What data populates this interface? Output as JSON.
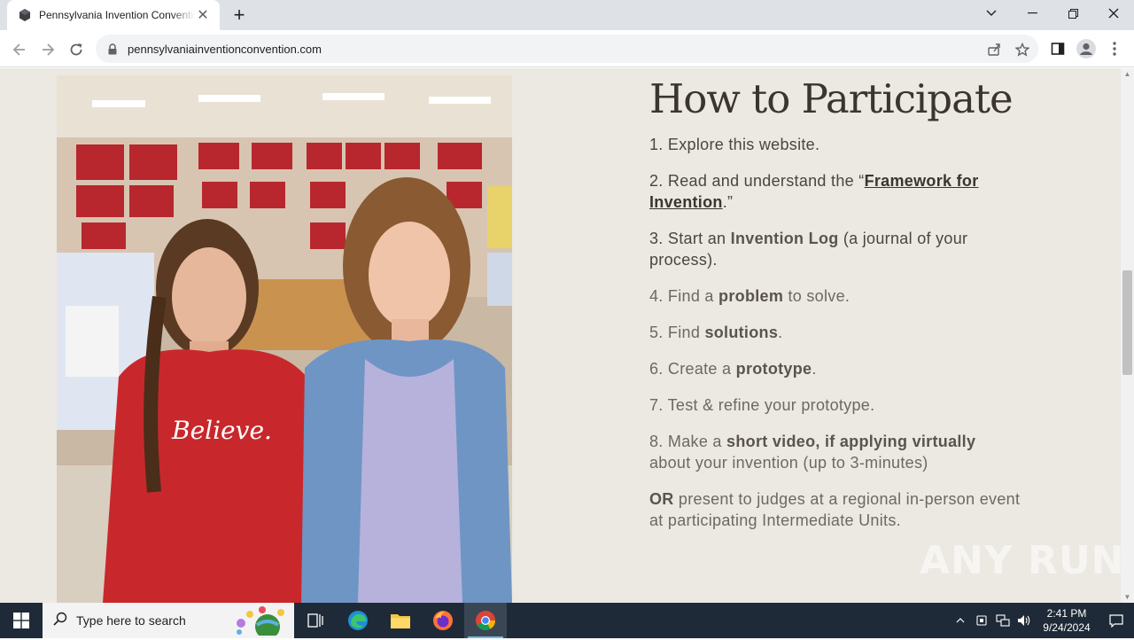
{
  "browser": {
    "tab_title": "Pennsylvania Invention Convention",
    "url": "pennsylvaniainventionconvention.com"
  },
  "page": {
    "heading": "How to Participate",
    "steps": [
      {
        "prefix": "1. Explore this website.",
        "bold": "",
        "suffix": ""
      },
      {
        "prefix": "2. Read and understand the “",
        "link": "Framework for Invention",
        "suffix": ".”"
      },
      {
        "prefix": "3. Start an ",
        "bold": "Invention Log",
        "suffix": " (a journal of your process)."
      },
      {
        "prefix": "4. Find a ",
        "bold": "problem",
        "suffix": " to solve."
      },
      {
        "prefix": "5. Find ",
        "bold": "solutions",
        "suffix": "."
      },
      {
        "prefix": "6. Create a ",
        "bold": "prototype",
        "suffix": "."
      },
      {
        "prefix": "7. Test & refine your prototype.",
        "bold": "",
        "suffix": ""
      },
      {
        "prefix": "8. Make a ",
        "bold": "short video, if applying virtually",
        "suffix": " about your invention (up to 3-minutes)"
      },
      {
        "prefix": "",
        "bold": "OR",
        "suffix": " present to judges at a regional in-person event at participating Intermediate Units."
      }
    ],
    "watermark": "ANY RUN"
  },
  "taskbar": {
    "search_placeholder": "Type here to search",
    "time": "2:41 PM",
    "date": "9/24/2024"
  },
  "colors": {
    "page_bg": "#ece8e2",
    "heading": "#3b3530",
    "body_text": "#6e6862",
    "taskbar": "#1f2a38"
  }
}
